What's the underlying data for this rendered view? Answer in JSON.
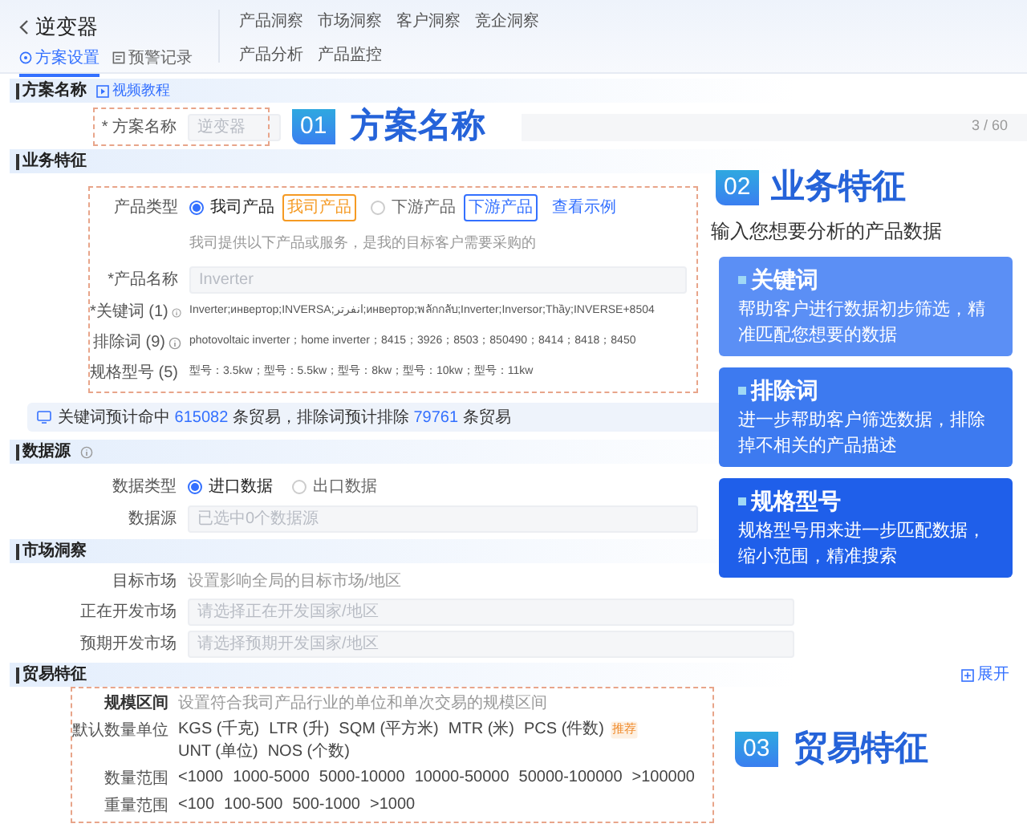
{
  "header": {
    "title": "逆变器",
    "tabs": [
      {
        "label": "方案设置",
        "selected": true
      },
      {
        "label": "预警记录",
        "selected": false
      }
    ],
    "nav": [
      [
        {
          "label": "产品洞察"
        },
        {
          "label": "市场洞察"
        },
        {
          "label": "客户洞察"
        },
        {
          "label": "竞企洞察"
        }
      ],
      [
        {
          "label": "产品分析"
        },
        {
          "label": "产品监控"
        }
      ]
    ]
  },
  "plan_name": {
    "title": "方案名称",
    "link": "视频教程",
    "field": {
      "label": "* 方案名称",
      "placeholder": "逆变器",
      "counter": "3 / 60"
    }
  },
  "business": {
    "title": "业务特征",
    "product_type": {
      "label": "产品类型",
      "options": [
        {
          "label": "我司产品",
          "selected": true,
          "tag": "我司产品",
          "color": "#f59a23"
        },
        {
          "label": "下游产品",
          "selected": false,
          "tag": "下游产品",
          "color": "#3370ff"
        }
      ],
      "link": "查看示例",
      "hint": "我司提供以下产品或服务，是我的目标客户需要采购的"
    },
    "product_name": {
      "label": "*产品名称",
      "placeholder": "Inverter"
    },
    "rows": [
      {
        "label": "*关键词 (1)",
        "value": "Inverter;инвертор;INVERSA;انفرتر;инвертор;พลักกลับ;Inverter;Inversor;Thầy;INVERSE+8504"
      },
      {
        "label": "排除词 (9)",
        "value": "photovoltaic inverter；home inverter；8415；3926；8503；850490；8414；8418；8450"
      },
      {
        "label": "规格型号 (5)",
        "value": "型号：3.5kw；型号：5.5kw；型号：8kw；型号：10kw；型号：11kw"
      }
    ]
  },
  "info_bar": {
    "segments": [
      {
        "kind": "plain",
        "text": "关键词预计命中 "
      },
      {
        "kind": "count",
        "text": "615082"
      },
      {
        "kind": "plain",
        "text": " 条贸易，排除词预计排除 "
      },
      {
        "kind": "count",
        "text": "79761"
      },
      {
        "kind": "plain",
        "text": " 条贸易"
      }
    ]
  },
  "data_source": {
    "title": "数据源",
    "type": {
      "label": "数据类型",
      "options": [
        {
          "label": "进口数据",
          "selected": true
        },
        {
          "label": "出口数据",
          "selected": false
        }
      ]
    },
    "source": {
      "label": "数据源",
      "placeholder": "已选中0个数据源"
    }
  },
  "market": {
    "title": "市场洞察",
    "target": {
      "label": "目标市场",
      "hint": "设置影响全局的目标市场/地区"
    },
    "fields": [
      {
        "label": "正在开发市场",
        "placeholder": "请选择正在开发国家/地区"
      },
      {
        "label": "预期开发市场",
        "placeholder": "请选择预期开发国家/地区"
      }
    ]
  },
  "trade": {
    "title": "贸易特征",
    "expand": "展开",
    "scale": {
      "label": "规模区间",
      "hint": "设置符合我司产品行业的单位和单次交易的规模区间"
    },
    "rows": [
      {
        "label": "默认数量单位",
        "options": [
          {
            "label": "KGS (千克)"
          },
          {
            "label": "LTR (升)"
          },
          {
            "label": "SQM (平方米)"
          },
          {
            "label": "MTR (米)"
          },
          {
            "label": "PCS (件数)",
            "badge": "推荐"
          },
          {
            "label": "UNT (单位)"
          },
          {
            "label": "NOS (个数)"
          }
        ]
      },
      {
        "label": "数量范围",
        "options": [
          {
            "label": "<1000"
          },
          {
            "label": "1000-5000"
          },
          {
            "label": "5000-10000"
          },
          {
            "label": "10000-50000"
          },
          {
            "label": "50000-100000"
          },
          {
            "label": ">100000"
          }
        ]
      },
      {
        "label": "重量范围",
        "options": [
          {
            "label": "<100"
          },
          {
            "label": "100-500"
          },
          {
            "label": "500-1000"
          },
          {
            "label": ">1000"
          }
        ]
      }
    ]
  },
  "callouts": {
    "plan_name": {
      "number": "01",
      "title": "方案名称"
    },
    "business": {
      "number": "02",
      "title": "业务特征",
      "subtitle": "输入您想要分析的产品数据",
      "cards": [
        {
          "title": "关键词",
          "text": "帮助客户进行数据初步筛选，精准匹配您想要的数据",
          "color": "#5b8ff5"
        },
        {
          "title": "排除词",
          "text": "进一步帮助客户筛选数据，排除掉不相关的产品描述",
          "color": "#3d7af0"
        },
        {
          "title": "规格型号",
          "text": "规格型号用来进一步匹配数据，缩小范围，精准搜索",
          "color": "#1f5fea"
        }
      ]
    },
    "trade": {
      "number": "03",
      "title": "贸易特征"
    }
  }
}
